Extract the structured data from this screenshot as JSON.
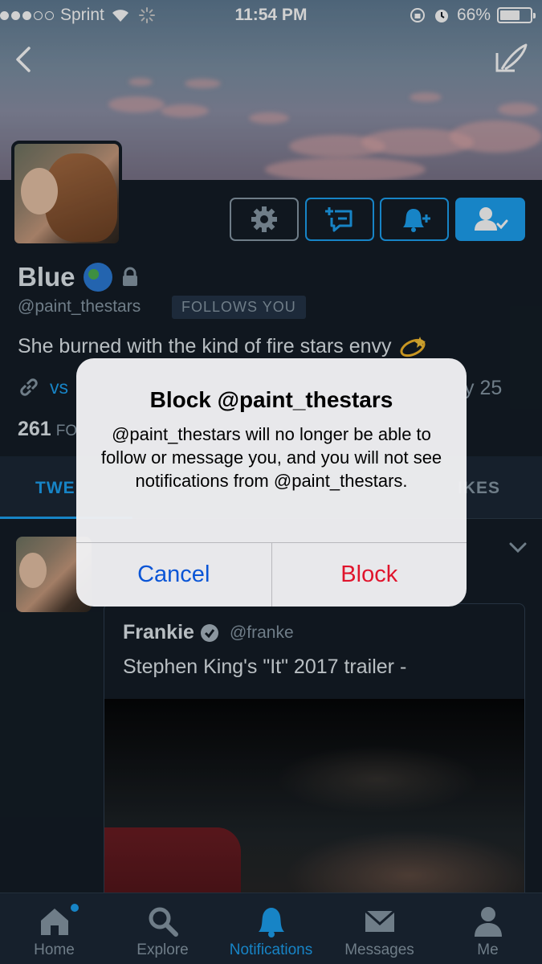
{
  "status_bar": {
    "carrier": "Sprint",
    "time": "11:54 PM",
    "battery": "66%",
    "battery_level": 0.66,
    "signal_bars": 3
  },
  "header": {
    "back_icon": "chevron-left-icon",
    "compose_icon": "compose-icon"
  },
  "profile": {
    "display_name": "Blue",
    "handle": "@paint_thestars",
    "follows_you": "FOLLOWS YOU",
    "bio": "She burned with the kind of fire stars envy",
    "link_fragment": "vs",
    "joined_fragment": "y 25",
    "count_value": "261",
    "count_fragment": "FO"
  },
  "actions": {
    "settings_icon": "gear-icon",
    "dm_icon": "direct-message-icon",
    "notify_icon": "bell-plus-icon",
    "following_icon": "person-check-icon"
  },
  "tabs": {
    "tweets_fragment": "TWE",
    "likes_fragment": "IKES"
  },
  "tweet": {
    "quoted_name": "Frankie",
    "quoted_handle": "@franke",
    "quoted_text": "Stephen King's \"It\" 2017 trailer -"
  },
  "bottom_nav": [
    {
      "label": "Home",
      "icon": "home-icon",
      "active": false
    },
    {
      "label": "Explore",
      "icon": "search-icon",
      "active": false
    },
    {
      "label": "Notifications",
      "icon": "bell-icon",
      "active": true
    },
    {
      "label": "Messages",
      "icon": "envelope-icon",
      "active": false
    },
    {
      "label": "Me",
      "icon": "person-icon",
      "active": false
    }
  ],
  "alert": {
    "title": "Block @paint_thestars",
    "message": "@paint_thestars will no longer be able to follow or message you, and you will not see notifications from @paint_thestars.",
    "cancel_label": "Cancel",
    "block_label": "Block"
  },
  "colors": {
    "accent": "#1da1f2",
    "background": "#141d26",
    "destructive": "#e0142c",
    "alert_button": "#0a55d6"
  }
}
